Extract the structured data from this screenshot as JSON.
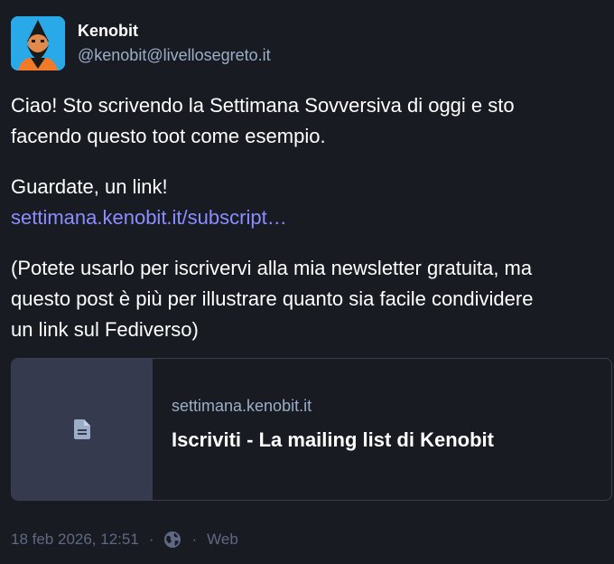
{
  "author": {
    "display_name": "Kenobit",
    "acct": "@kenobit@livellosegreto.it",
    "avatar_icon": "bearded-man-avatar",
    "avatar_bg": "#2aa9e8"
  },
  "content": {
    "p1_line1": "Ciao! Sto scrivendo la Settimana Sovversiva di oggi e sto",
    "p1_line2": "facendo questo toot come esempio.",
    "p2_line1": "Guardate, un link!",
    "p2_link": "settimana.kenobit.it/subscript…",
    "p3_line1": "(Potete usarlo per iscrivervi alla mia newsletter gratuita, ma",
    "p3_line2": "questo post è più per illustrare quanto sia facile condividere",
    "p3_line3": "un link sul Fediverso)"
  },
  "card": {
    "thumb_icon": "document-icon",
    "host": "settimana.kenobit.it",
    "title": "Iscriviti - La mailing list di Kenobit"
  },
  "meta": {
    "timestamp": "18 feb 2026, 12:51",
    "separator": "·",
    "visibility_icon": "globe-icon",
    "application": "Web"
  },
  "colors": {
    "background": "#191b22",
    "link": "#8c8dff",
    "muted": "#9baec8",
    "meta": "#606984",
    "card_thumb": "#363a4e"
  }
}
